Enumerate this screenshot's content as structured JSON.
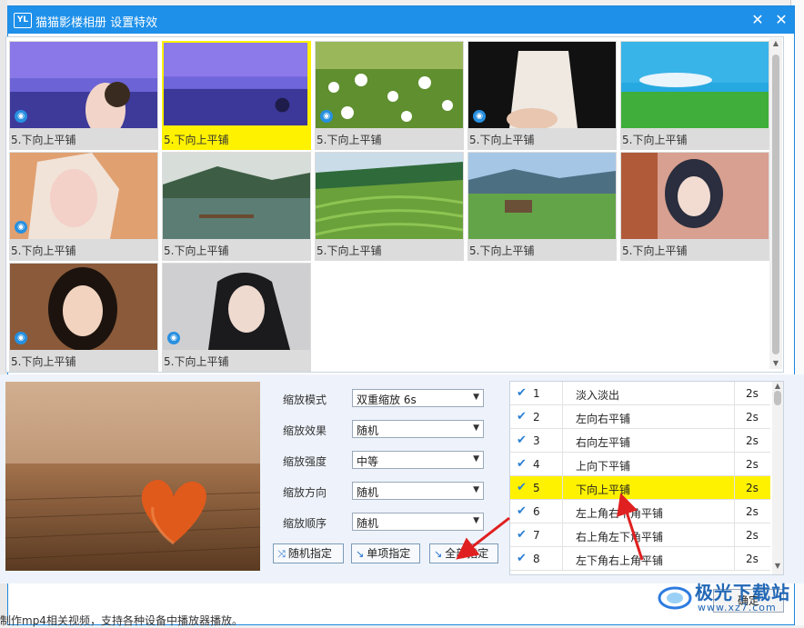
{
  "window": {
    "logo": "YL",
    "title": "猫猫影楼相册 设置特效",
    "minimize_icon": "minimize-icon",
    "close_icon": "close-icon"
  },
  "thumbnails": [
    {
      "caption": "5.下向上平铺",
      "preview": true,
      "selected": false,
      "scene": "purple-sky-girl"
    },
    {
      "caption": "5.下向上平铺",
      "preview": false,
      "selected": true,
      "scene": "purple-sky"
    },
    {
      "caption": "5.下向上平铺",
      "preview": true,
      "selected": false,
      "scene": "daisies"
    },
    {
      "caption": "5.下向上平铺",
      "preview": true,
      "selected": false,
      "scene": "white-coat"
    },
    {
      "caption": "5.下向上平铺",
      "preview": false,
      "selected": false,
      "scene": "green-field"
    },
    {
      "caption": "5.下向上平铺",
      "preview": true,
      "selected": false,
      "scene": "blonde-girl"
    },
    {
      "caption": "5.下向上平铺",
      "preview": false,
      "selected": false,
      "scene": "lake-dock"
    },
    {
      "caption": "5.下向上平铺",
      "preview": false,
      "selected": false,
      "scene": "rice-terraces"
    },
    {
      "caption": "5.下向上平铺",
      "preview": false,
      "selected": false,
      "scene": "valley-hut"
    },
    {
      "caption": "5.下向上平铺",
      "preview": false,
      "selected": false,
      "scene": "anime-girl"
    },
    {
      "caption": "5.下向上平铺",
      "preview": true,
      "selected": false,
      "scene": "costume-girl"
    },
    {
      "caption": "5.下向上平铺",
      "preview": true,
      "selected": false,
      "scene": "grey-girl"
    }
  ],
  "settings": [
    {
      "label": "缩放模式",
      "value": "双重缩放  6s"
    },
    {
      "label": "缩放效果",
      "value": "随机"
    },
    {
      "label": "缩放强度",
      "value": "中等"
    },
    {
      "label": "缩放方向",
      "value": "随机"
    },
    {
      "label": "缩放顺序",
      "value": "随机"
    }
  ],
  "buttons": {
    "random": "随机指定",
    "single": "单项指定",
    "all": "全部指定",
    "ok": "确定"
  },
  "effects": [
    {
      "num": "1",
      "name": "淡入淡出",
      "duration": "2s",
      "selected": false
    },
    {
      "num": "2",
      "name": "左向右平铺",
      "duration": "2s",
      "selected": false
    },
    {
      "num": "3",
      "name": "右向左平铺",
      "duration": "2s",
      "selected": false
    },
    {
      "num": "4",
      "name": "上向下平铺",
      "duration": "2s",
      "selected": false
    },
    {
      "num": "5",
      "name": "下向上平铺",
      "duration": "2s",
      "selected": true
    },
    {
      "num": "6",
      "name": "左上角右下角平铺",
      "duration": "2s",
      "selected": false
    },
    {
      "num": "7",
      "name": "右上角左下角平铺",
      "duration": "2s",
      "selected": false
    },
    {
      "num": "8",
      "name": "左下角右上角平铺",
      "duration": "2s",
      "selected": false
    }
  ],
  "watermark": {
    "main": "极光下载站",
    "sub": "www.xz7.com"
  },
  "background_text": "制作mp4相关视频，支持各种设备中播放器播放。",
  "colors": {
    "accent": "#1e90ea",
    "selection": "#fff200",
    "arrow": "#e02020"
  }
}
